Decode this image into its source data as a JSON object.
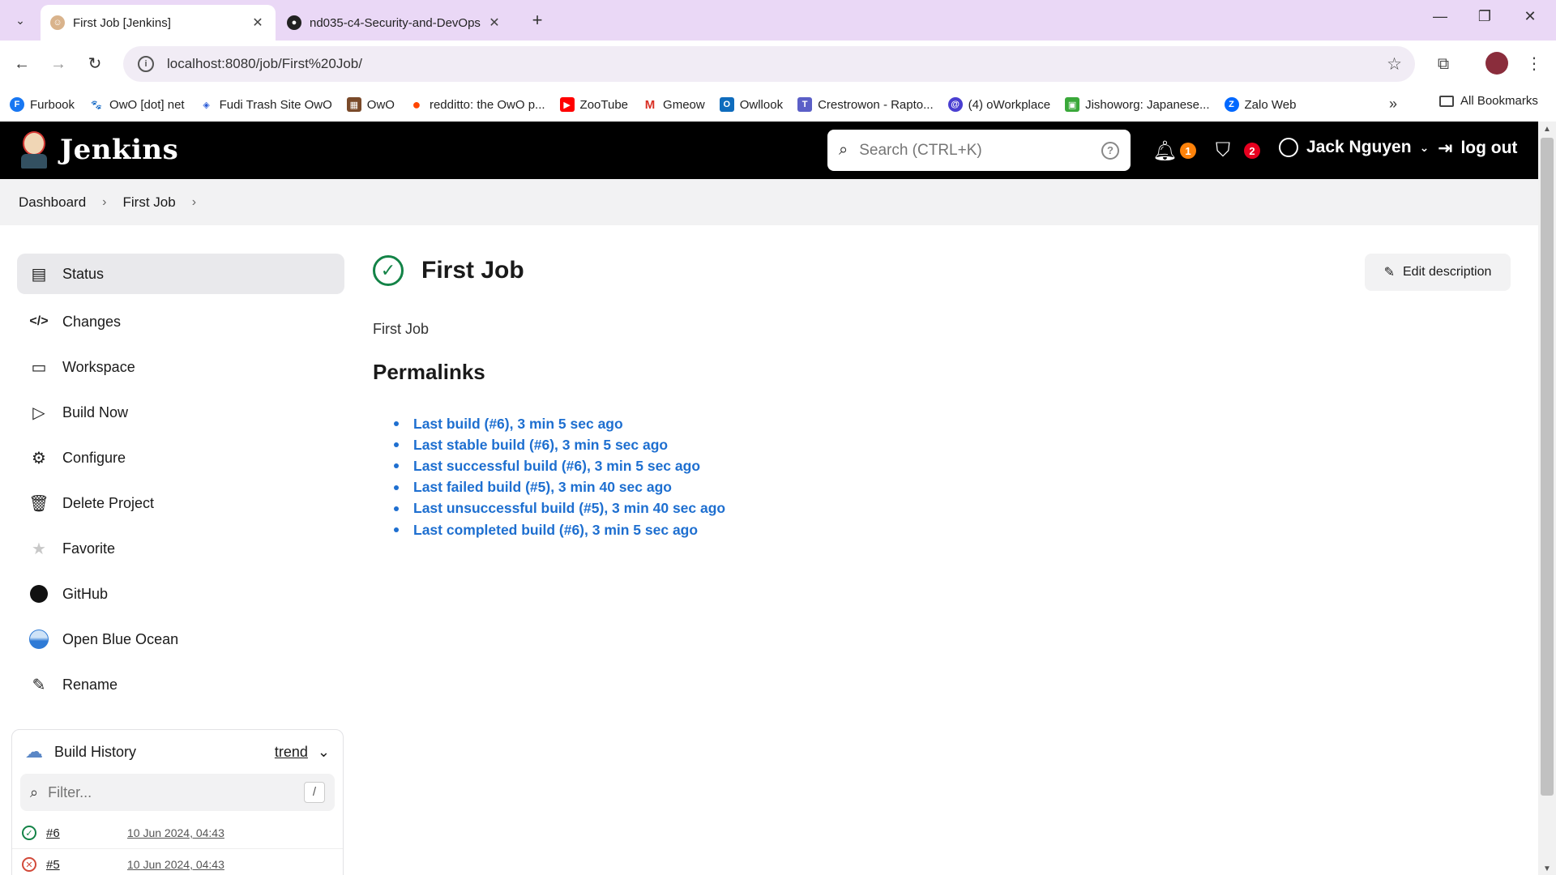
{
  "browser": {
    "tabs": [
      {
        "title": "First Job [Jenkins]",
        "active": true
      },
      {
        "title": "nd035-c4-Security-and-DevOps",
        "active": false
      }
    ],
    "url": "localhost:8080/job/First%20Job/",
    "bookmarks": [
      {
        "label": "Furbook",
        "color": "#1877f2",
        "icon": "F"
      },
      {
        "label": "OwO [dot] net",
        "color": "#222222",
        "icon": "🐾"
      },
      {
        "label": "Fudi Trash Site OwO",
        "color": "#2a5bd7",
        "icon": "◈"
      },
      {
        "label": "OwO",
        "color": "#7a4a2a",
        "icon": "▦"
      },
      {
        "label": "redditto: the OwO p...",
        "color": "#ff4500",
        "icon": "●"
      },
      {
        "label": "ZooTube",
        "color": "#ff0000",
        "icon": "▶"
      },
      {
        "label": "Gmeow",
        "color": "#d93025",
        "icon": "M"
      },
      {
        "label": "Owllook",
        "color": "#0f6cbd",
        "icon": "O"
      },
      {
        "label": "Crestrowon - Rapto...",
        "color": "#5b5fc7",
        "icon": "T"
      },
      {
        "label": "(4) oWorkplace",
        "color": "#4a3fd1",
        "icon": "@"
      },
      {
        "label": "Jishoworg: Japanese...",
        "color": "#3aa83a",
        "icon": "▣"
      },
      {
        "label": "Zalo Web",
        "color": "#0068ff",
        "icon": "Z"
      }
    ],
    "all_bookmarks": "All Bookmarks"
  },
  "header": {
    "brand": "Jenkins",
    "search_placeholder": "Search (CTRL+K)",
    "notifications_count": "1",
    "security_count": "2",
    "user_name": "Jack Nguyen",
    "logout": "log out"
  },
  "breadcrumb": [
    "Dashboard",
    "First Job"
  ],
  "sidebar": {
    "items": [
      {
        "label": "Status",
        "icon": "status-icon"
      },
      {
        "label": "Changes",
        "icon": "code-icon"
      },
      {
        "label": "Workspace",
        "icon": "folder-icon"
      },
      {
        "label": "Build Now",
        "icon": "play-icon"
      },
      {
        "label": "Configure",
        "icon": "gear-icon"
      },
      {
        "label": "Delete Project",
        "icon": "trash-icon"
      },
      {
        "label": "Favorite",
        "icon": "star-icon"
      },
      {
        "label": "GitHub",
        "icon": "github-icon"
      },
      {
        "label": "Open Blue Ocean",
        "icon": "blue-ocean-icon"
      },
      {
        "label": "Rename",
        "icon": "pencil-icon"
      }
    ]
  },
  "build_history": {
    "title": "Build History",
    "trend": "trend",
    "filter_placeholder": "Filter...",
    "filter_shortcut": "/",
    "builds": [
      {
        "number": "#6",
        "date": "10 Jun 2024, 04:43",
        "status": "success"
      },
      {
        "number": "#5",
        "date": "10 Jun 2024, 04:43",
        "status": "failed"
      }
    ]
  },
  "main": {
    "title": "First Job",
    "edit_description": "Edit description",
    "description": "First Job",
    "permalinks_heading": "Permalinks",
    "permalinks": [
      "Last build (#6), 3 min 5 sec ago",
      "Last stable build (#6), 3 min 5 sec ago",
      "Last successful build (#6), 3 min 5 sec ago",
      "Last failed build (#5), 3 min 40 sec ago",
      "Last unsuccessful build (#5), 3 min 40 sec ago",
      "Last completed build (#6), 3 min 5 sec ago"
    ]
  }
}
